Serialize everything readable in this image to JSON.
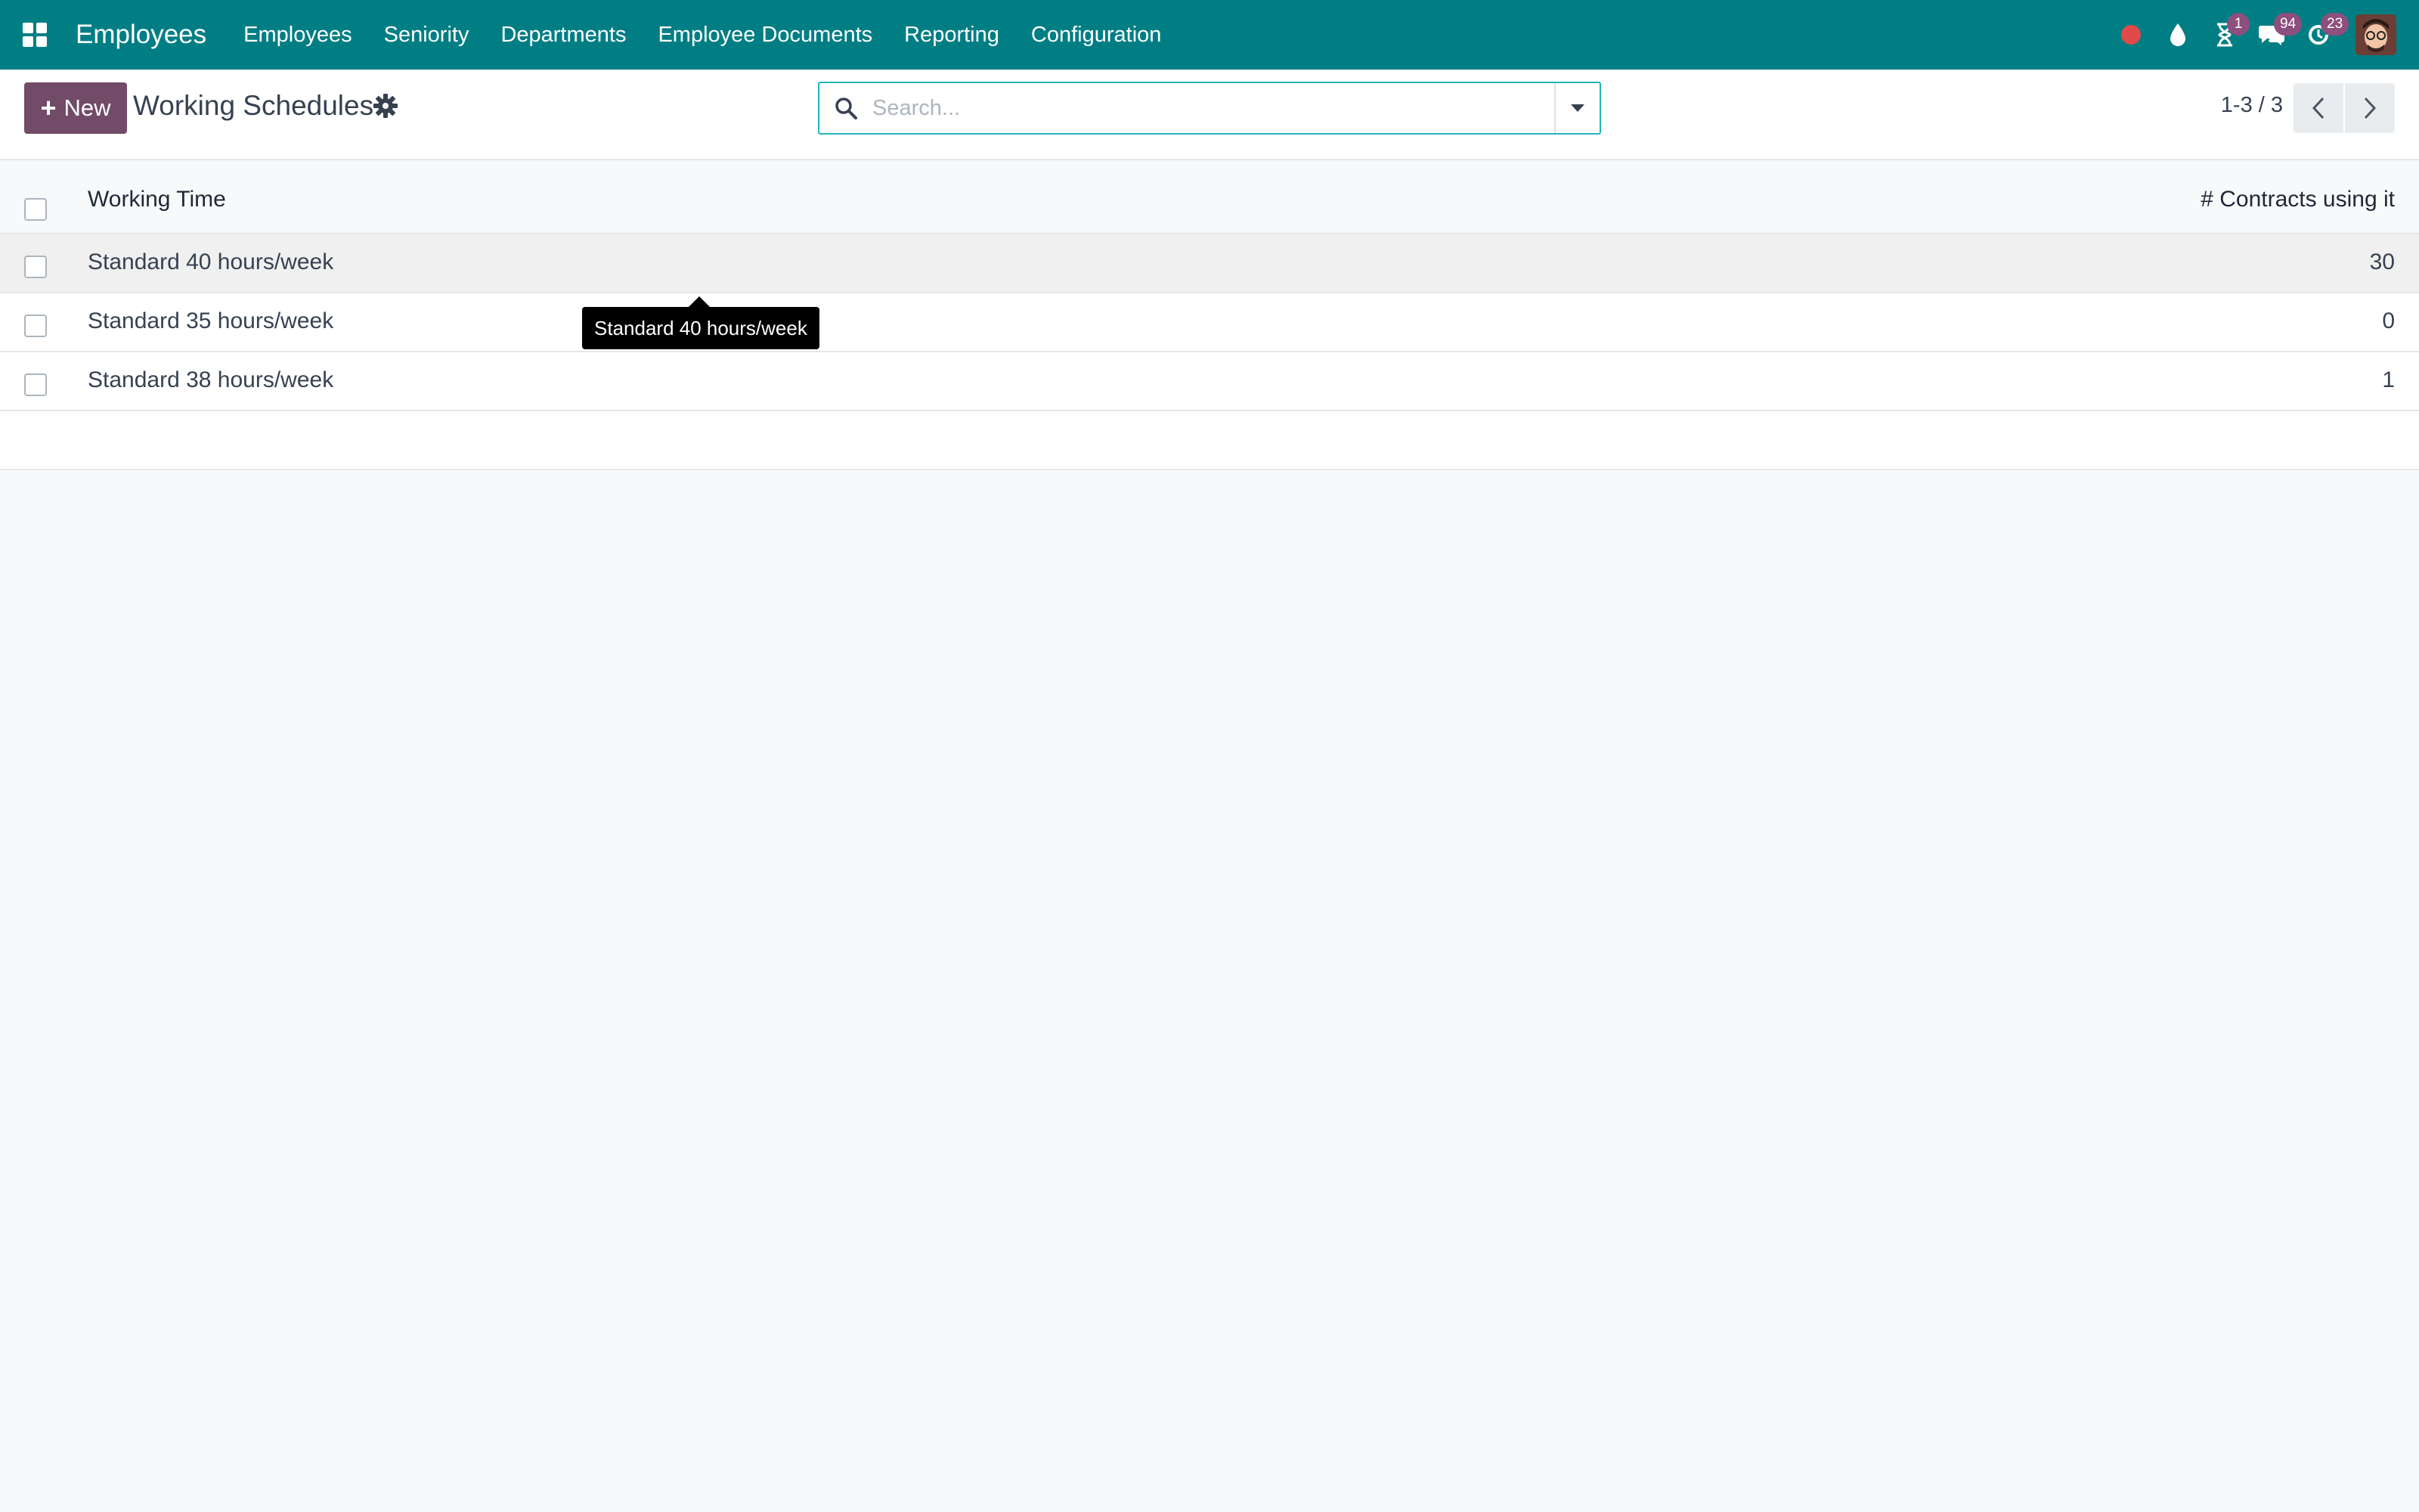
{
  "navbar": {
    "apps_icon": "grid-icon",
    "brand": "Employees",
    "menu": [
      {
        "label": "Employees"
      },
      {
        "label": "Seniority"
      },
      {
        "label": "Departments"
      },
      {
        "label": "Employee Documents"
      },
      {
        "label": "Reporting"
      },
      {
        "label": "Configuration"
      }
    ],
    "systray": {
      "recording_icon": "red-dot-icon",
      "drop_icon": "water-drop-icon",
      "activity_badge": "1",
      "messages_badge": "94",
      "refresh_badge": "23",
      "avatar_icon": "user-avatar"
    },
    "colors": {
      "navbar_bg": "#017e84",
      "badge_bg": "#8d4f7d",
      "dot": "#e04a4a"
    }
  },
  "control_panel": {
    "new_button": "New",
    "title": "Working Schedules",
    "search_placeholder": "Search...",
    "pager": "1-3 / 3",
    "colors": {
      "new_button_bg": "#714b67",
      "search_border": "#21b5bc"
    }
  },
  "table": {
    "columns": [
      "Working Time",
      "# Contracts using it"
    ],
    "rows": [
      {
        "name": "Standard 40 hours/week",
        "count": "30"
      },
      {
        "name": "Standard 35 hours/week",
        "count": "0"
      },
      {
        "name": "Standard 38 hours/week",
        "count": "1"
      }
    ]
  },
  "tooltip": {
    "text": "Standard 40 hours/week"
  }
}
